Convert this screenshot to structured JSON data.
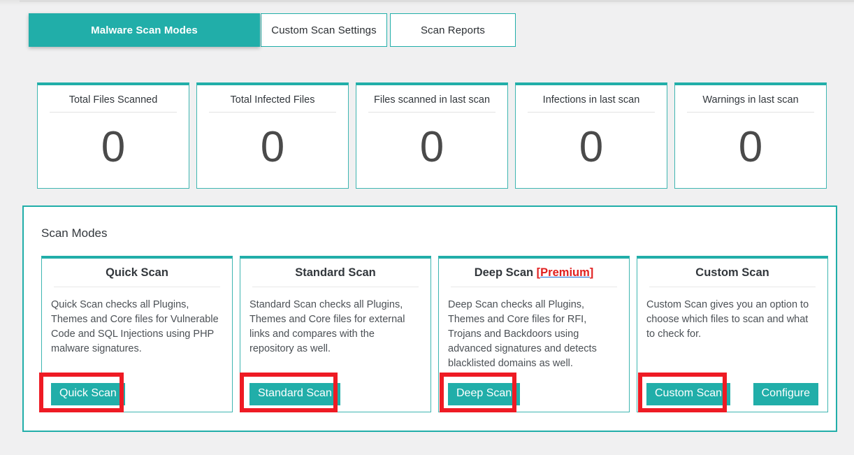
{
  "tabs": [
    {
      "label": "Malware Scan Modes",
      "active": true
    },
    {
      "label": "Custom Scan Settings",
      "active": false
    },
    {
      "label": "Scan Reports",
      "active": false
    }
  ],
  "stats": [
    {
      "title": "Total Files Scanned",
      "value": "0"
    },
    {
      "title": "Total Infected Files",
      "value": "0"
    },
    {
      "title": "Files scanned in last scan",
      "value": "0"
    },
    {
      "title": "Infections in last scan",
      "value": "0"
    },
    {
      "title": "Warnings in last scan",
      "value": "0"
    }
  ],
  "panel": {
    "title": "Scan Modes",
    "modes": [
      {
        "title": "Quick Scan",
        "premium_prefix": "",
        "premium_label": "",
        "premium_suffix": "",
        "description": "Quick Scan checks all Plugins, Themes and Core files for Vulnerable Code and SQL Injections using PHP malware signatures.",
        "primary_button": "Quick Scan",
        "secondary_button": ""
      },
      {
        "title": "Standard Scan",
        "premium_prefix": "",
        "premium_label": "",
        "premium_suffix": "",
        "description": "Standard Scan checks all Plugins, Themes and Core files for external links and compares with the repository as well.",
        "primary_button": "Standard Scan",
        "secondary_button": ""
      },
      {
        "title": "Deep Scan ",
        "premium_prefix": "[",
        "premium_label": "Premium",
        "premium_suffix": "]",
        "description": "Deep Scan checks all Plugins, Themes and Core files for RFI, Trojans and Backdoors using advanced signatures and detects blacklisted domains as well.",
        "primary_button": "Deep Scan",
        "secondary_button": ""
      },
      {
        "title": "Custom Scan",
        "premium_prefix": "",
        "premium_label": "",
        "premium_suffix": "",
        "description": "Custom Scan gives you an option to choose which files to scan and what to check for.",
        "primary_button": "Custom Scan",
        "secondary_button": "Configure"
      }
    ]
  },
  "colors": {
    "accent_teal": "#21aea9",
    "card_border_teal": "#3fb6b1",
    "annotation_red": "#ee1b24",
    "premium_red": "#e02020",
    "page_background": "#f0f0f1"
  }
}
